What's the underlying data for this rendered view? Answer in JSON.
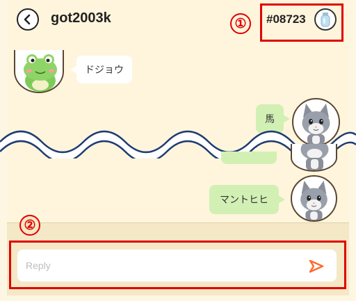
{
  "header": {
    "back_icon": "chevron-left-icon",
    "username": "got2003k",
    "user_id": "#08723",
    "avatar_icon": "bottle-avatar-icon"
  },
  "annotations": {
    "callout_1": "①",
    "callout_2": "②",
    "highlight_color": "#e00000"
  },
  "messages": [
    {
      "sender": "frog",
      "side": "left",
      "text": "ドジョウ",
      "avatar_icon": "frog-avatar-icon"
    },
    {
      "sender": "cat",
      "side": "right",
      "text": "馬",
      "avatar_icon": "cat-avatar-icon"
    },
    {
      "sender": "cat",
      "side": "right",
      "text": "",
      "avatar_icon": "cat-avatar-icon"
    },
    {
      "sender": "cat",
      "side": "right",
      "text": "マントヒヒ",
      "avatar_icon": "cat-avatar-icon"
    }
  ],
  "composer": {
    "placeholder": "Reply",
    "value": "",
    "send_icon": "send-icon"
  },
  "colors": {
    "chat_background": "#fff5dc",
    "composer_background": "#f5e8c6",
    "own_bubble": "#d2f0b4",
    "other_bubble": "#ffffff",
    "send_icon": "#ff6a2b",
    "wave": "#1f3c73"
  }
}
